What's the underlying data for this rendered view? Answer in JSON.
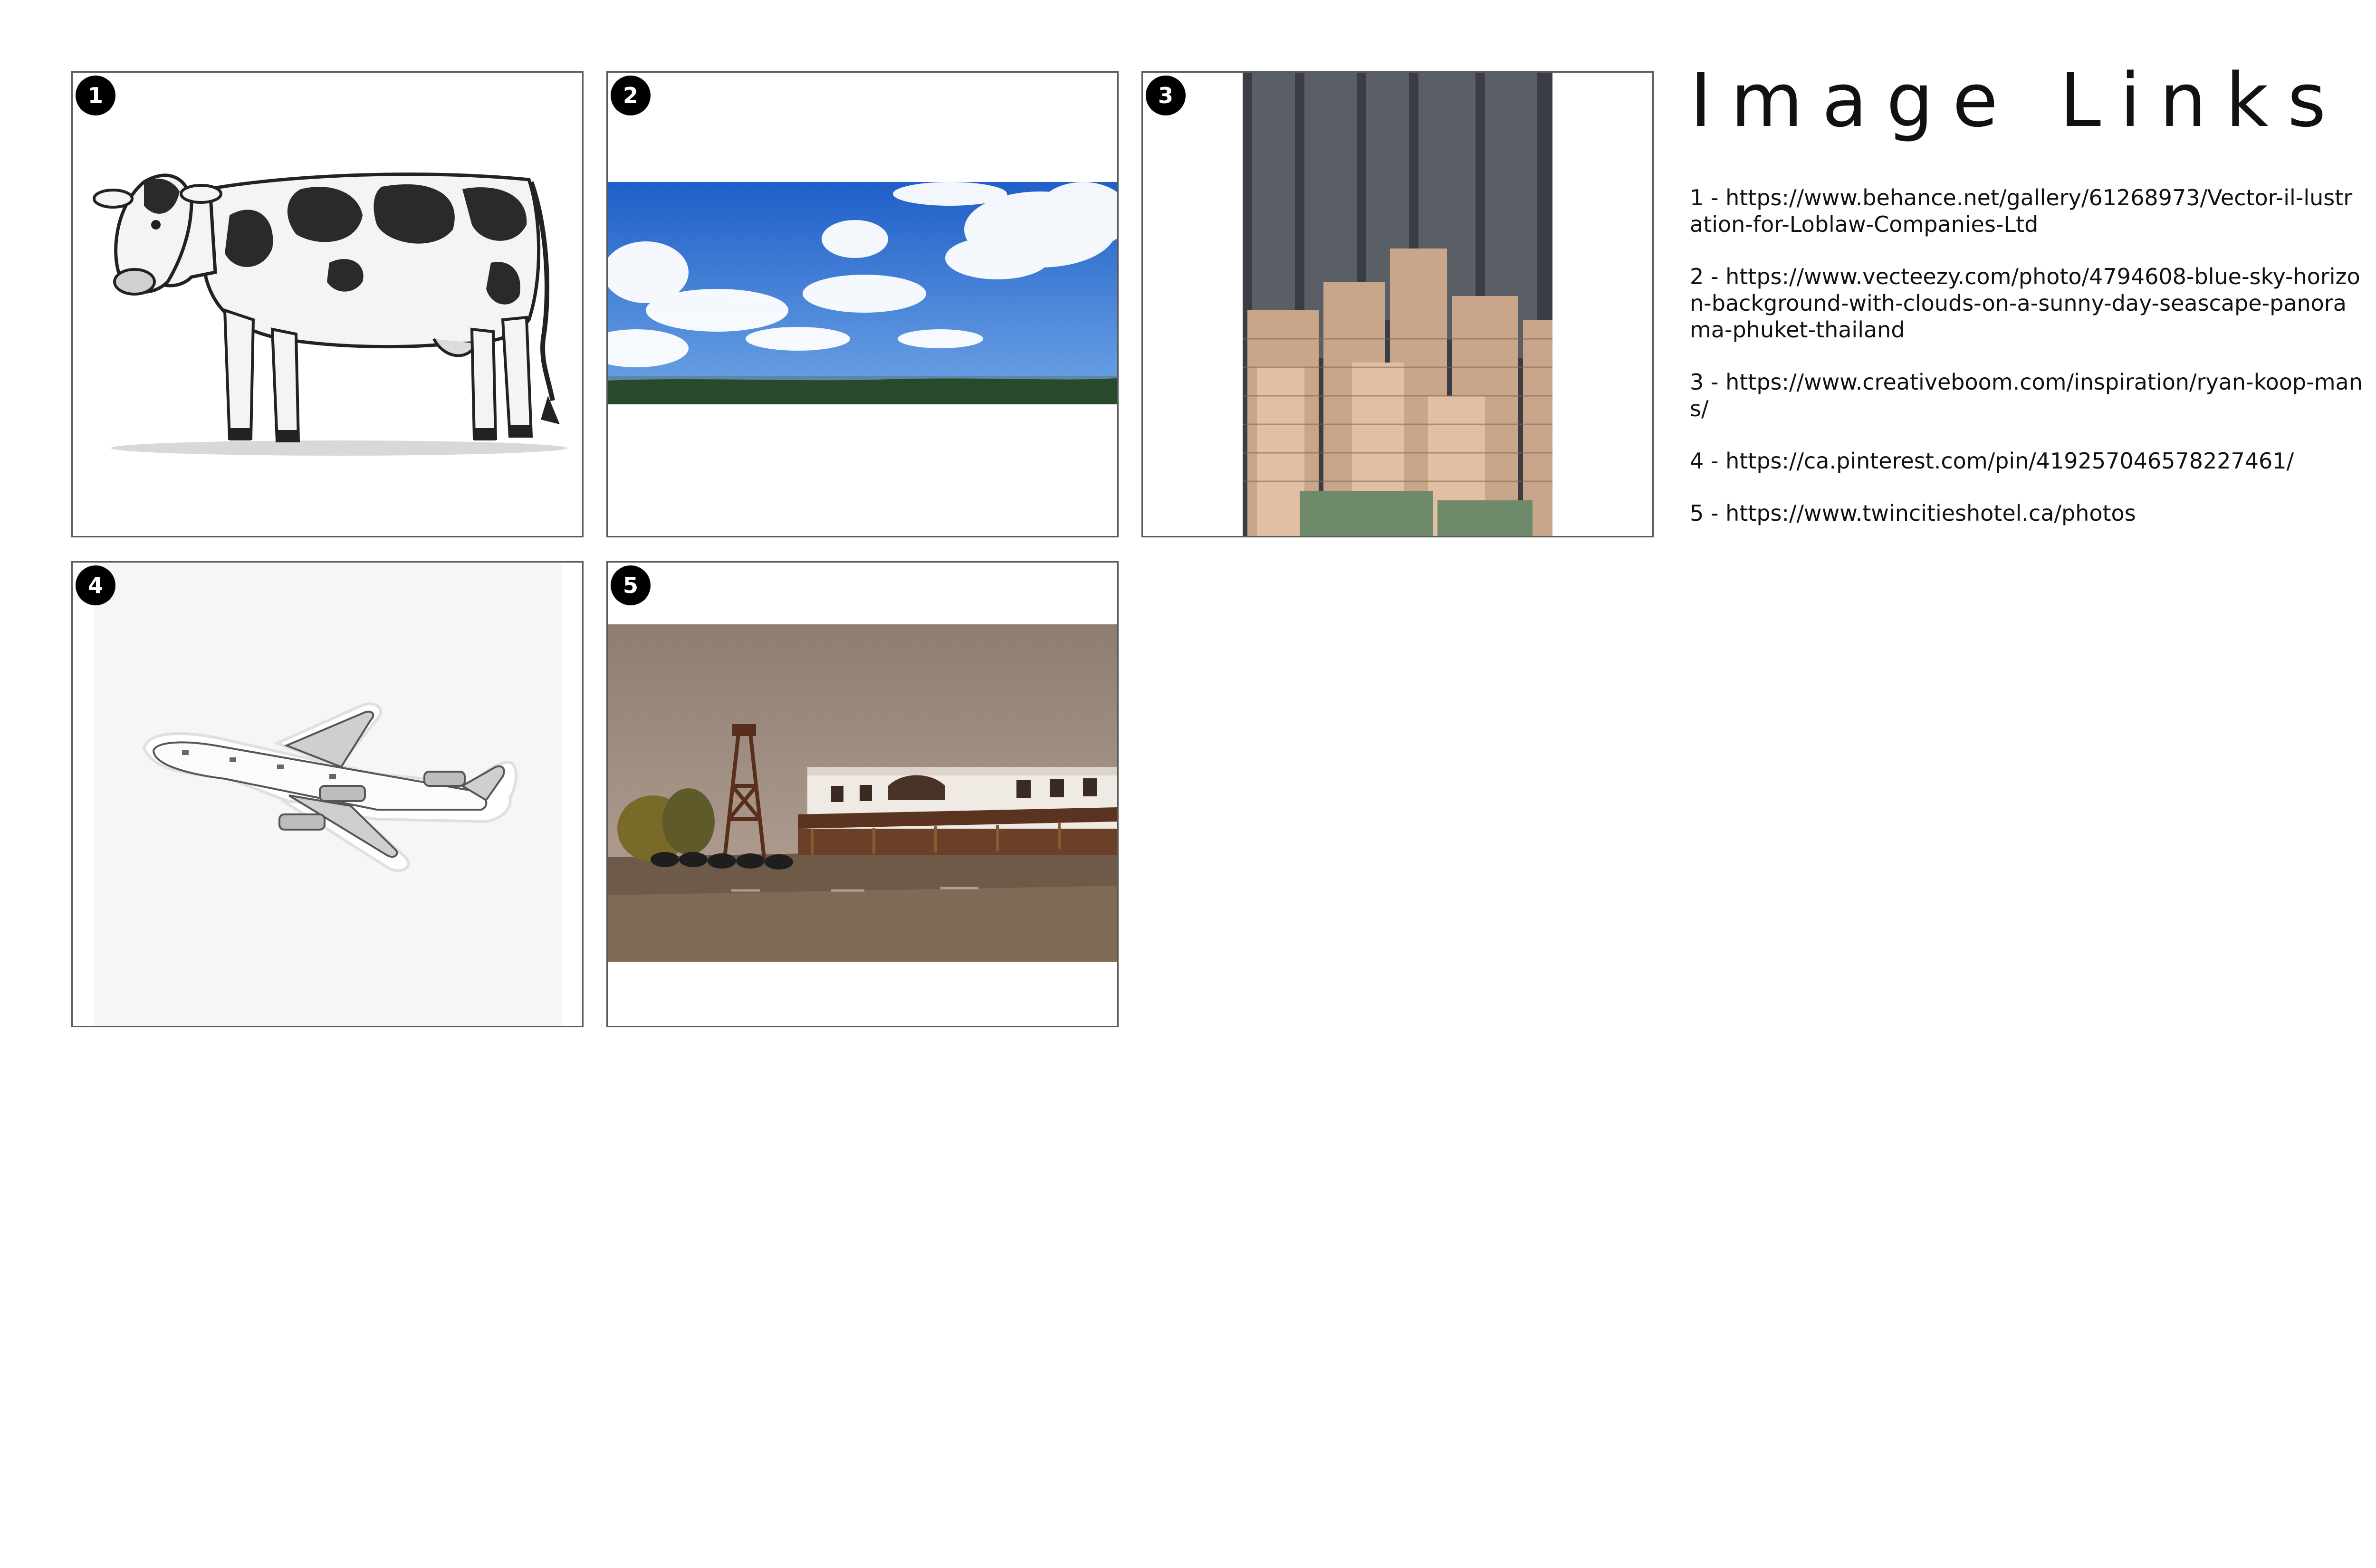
{
  "title": "Image Links",
  "images": [
    {
      "number": "1",
      "subject": "cow illustration"
    },
    {
      "number": "2",
      "subject": "blue sky with clouds"
    },
    {
      "number": "3",
      "subject": "high-rise apartment towers"
    },
    {
      "number": "4",
      "subject": "airplane sticker"
    },
    {
      "number": "5",
      "subject": "hotel with wooden tower"
    }
  ],
  "links": [
    {
      "text": "1 - https://www.behance.net/gallery/61268973/Vector-il-lustration-for-Loblaw-Companies-Ltd"
    },
    {
      "text": "2 - https://www.vecteezy.com/photo/4794608-blue-sky-horizon-background-with-clouds-on-a-sunny-day-seascape-panorama-phuket-thailand"
    },
    {
      "text": "3 - https://www.creativeboom.com/inspiration/ryan-koop-mans/"
    },
    {
      "text": "4 - https://ca.pinterest.com/pin/419257046578227461/"
    },
    {
      "text": "5 - https://www.twincitieshotel.ca/photos"
    }
  ],
  "colors": {
    "badge": "#000000",
    "frame_border": "#5a5a5a",
    "sky": "#2f6fd6"
  }
}
